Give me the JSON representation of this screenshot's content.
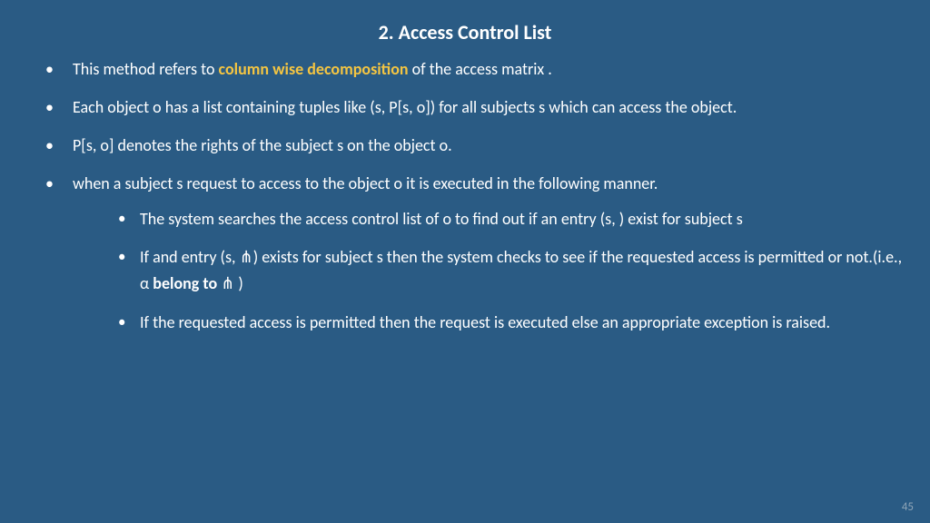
{
  "title": "2. Access Control List",
  "bullets": {
    "b1a": "This method refers to ",
    "b1h": "column wise decomposition",
    "b1b": " of the access matrix .",
    "b2": "Each object o has a list containing tuples like (s, P[s, o]) for all subjects s which can access the object.",
    "b3": "P[s, o] denotes the rights of the subject s on the object o.",
    "b4": "when a subject s request to access  to the object o it is executed in the following manner.",
    "s1": "The system searches the access control list of o to find out if an entry (s, ) exist for subject s",
    "s2a": "If and entry (s, ⋔) exists for subject s then the system checks to see if the requested access is permitted or not.(i.e., α ",
    "s2bold": "belong to",
    "s2b": "  ⋔  )",
    "s3": "If the requested access is permitted then the request is executed else an appropriate exception is raised."
  },
  "page": "45"
}
